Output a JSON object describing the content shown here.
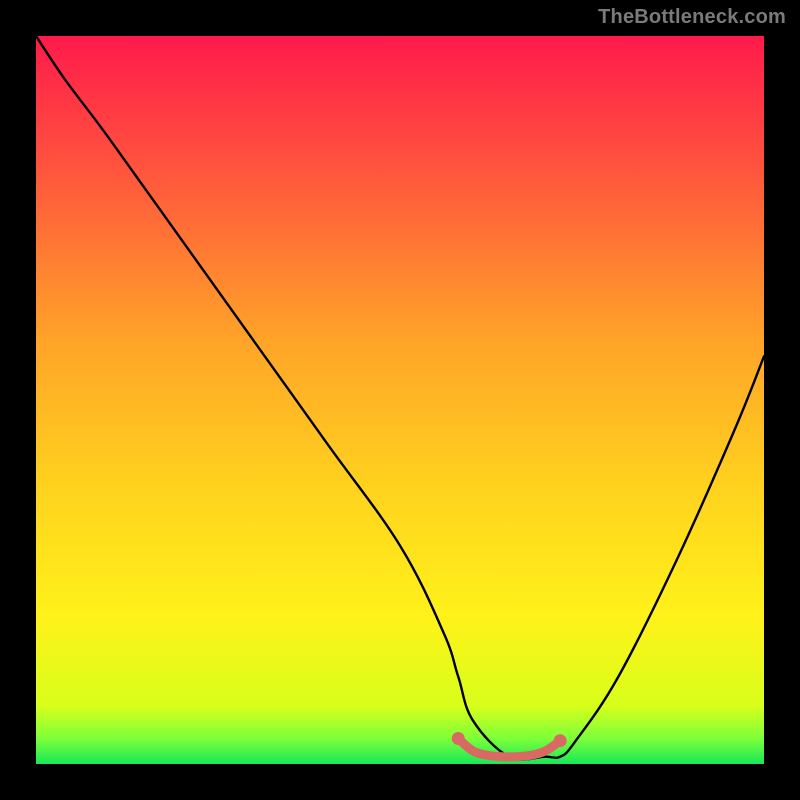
{
  "watermark": "TheBottleneck.com",
  "chart_data": {
    "type": "line",
    "title": "",
    "xlabel": "",
    "ylabel": "",
    "xlim": [
      0,
      100
    ],
    "ylim": [
      0,
      100
    ],
    "grid": false,
    "legend": false,
    "series": [
      {
        "name": "curve",
        "x": [
          0,
          4,
          10,
          20,
          30,
          40,
          50,
          56,
          58,
          60,
          65,
          70,
          72,
          74,
          80,
          88,
          96,
          100
        ],
        "y": [
          100,
          94,
          86,
          72,
          58,
          44,
          30,
          18,
          12,
          6,
          1,
          1,
          1,
          3,
          12,
          28,
          46,
          56
        ]
      }
    ],
    "valley_marker": {
      "color": "#d86a63",
      "x": [
        58,
        60,
        62,
        64,
        66,
        68,
        70,
        72
      ],
      "y": [
        3.5,
        1.8,
        1.2,
        1.0,
        1.0,
        1.2,
        1.8,
        3.2
      ]
    },
    "gradient_stops": [
      {
        "offset": 0.0,
        "color": "#ff1a4b"
      },
      {
        "offset": 0.2,
        "color": "#ff5a3c"
      },
      {
        "offset": 0.42,
        "color": "#ffa428"
      },
      {
        "offset": 0.62,
        "color": "#ffd21e"
      },
      {
        "offset": 0.8,
        "color": "#fff21a"
      },
      {
        "offset": 0.92,
        "color": "#d8ff1a"
      },
      {
        "offset": 0.965,
        "color": "#7dff3a"
      },
      {
        "offset": 1.0,
        "color": "#17e858"
      }
    ]
  }
}
